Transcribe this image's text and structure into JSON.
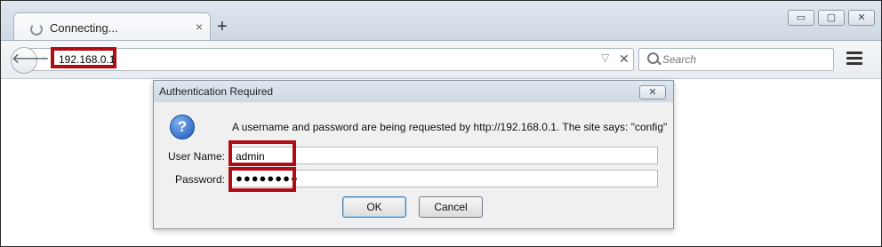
{
  "browser": {
    "tab_title": "Connecting...",
    "tab_close": "×",
    "new_tab": "+",
    "window_buttons": {
      "minimize": "▭",
      "maximize": "▢",
      "close": "✕"
    },
    "back": "🡐",
    "url": "192.168.0.1",
    "url_dropdown": "▽",
    "url_stop": "✕",
    "search_placeholder": "Search",
    "icons": [
      "back-arrow-icon",
      "globe-icon",
      "search-icon",
      "hamburger-menu-icon",
      "loading-spinner-icon"
    ]
  },
  "dialog": {
    "title": "Authentication Required",
    "close": "✕",
    "message": "A username and password are being requested by http://192.168.0.1. The site says: \"config\"",
    "username_label": "User Name:",
    "username_value": "admin",
    "password_label": "Password:",
    "password_value": "●●●●●●●●",
    "ok_label": "OK",
    "cancel_label": "Cancel",
    "question_glyph": "?"
  },
  "colors": {
    "highlight": "#b00c14",
    "question_icon": "#1c57b8"
  }
}
